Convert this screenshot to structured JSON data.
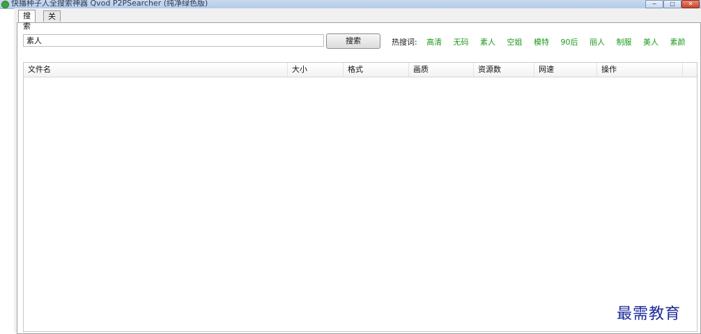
{
  "window": {
    "title": "快播种子人全搜索神器 Qvod P2PSearcher (纯净绿色版)",
    "controls": {
      "minimize": "−",
      "maximize": "□",
      "close": "✕"
    }
  },
  "tabs": [
    {
      "label": "搜索",
      "active": true
    },
    {
      "label": "关于",
      "active": false
    }
  ],
  "search": {
    "value": "素人",
    "button_label": "搜索"
  },
  "hot_words": {
    "label": "热搜词:",
    "items": [
      "高清",
      "无码",
      "素人",
      "空姐",
      "模特",
      "90后",
      "丽人",
      "制服",
      "美人",
      "素颜"
    ]
  },
  "table": {
    "columns": [
      "文件名",
      "大小",
      "格式",
      "画质",
      "资源数",
      "网速",
      "操作"
    ],
    "rows": []
  },
  "watermark": "最需教育",
  "colors": {
    "hot_word": "#1a9a1a",
    "watermark": "#1d2a9a"
  }
}
